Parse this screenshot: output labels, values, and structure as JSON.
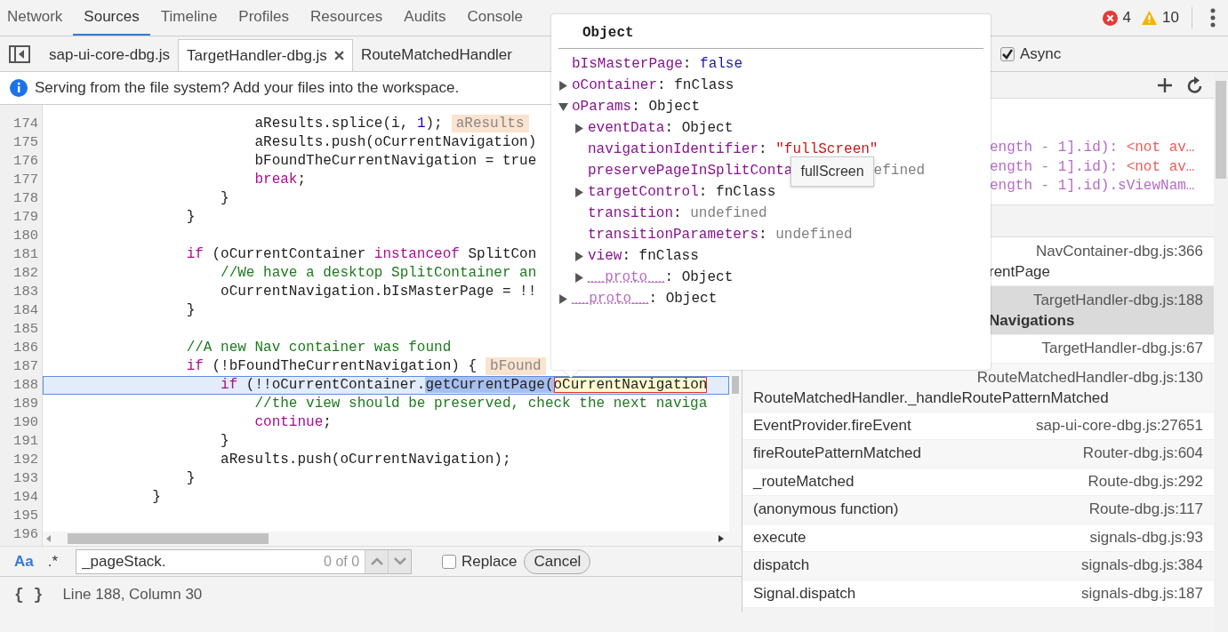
{
  "main_tabs": [
    {
      "label": "Network",
      "selected": false
    },
    {
      "label": "Sources",
      "selected": true
    },
    {
      "label": "Timeline",
      "selected": false
    },
    {
      "label": "Profiles",
      "selected": false
    },
    {
      "label": "Resources",
      "selected": false
    },
    {
      "label": "Audits",
      "selected": false
    },
    {
      "label": "Console",
      "selected": false
    }
  ],
  "issues": {
    "errors": "4",
    "warnings": "10"
  },
  "file_tabs": [
    {
      "label": "sap-ui-core-dbg.js",
      "selected": false,
      "closable": false
    },
    {
      "label": "TargetHandler-dbg.js",
      "selected": true,
      "closable": true
    },
    {
      "label": "RouteMatchedHandler",
      "selected": false,
      "closable": false
    }
  ],
  "async": {
    "label": "Async",
    "checked": true
  },
  "info_bar": "Serving from the file system? Add your files into the workspace.",
  "code": {
    "lines": [
      {
        "number": "174",
        "current": false,
        "segments": [
          {
            "kind": "plain",
            "text": "                        aResults.splice(i, "
          },
          {
            "kind": "number",
            "text": "1"
          },
          {
            "kind": "plain",
            "text": ");"
          },
          {
            "kind": "inline_value",
            "text": "aResults"
          }
        ]
      },
      {
        "number": "175",
        "current": false,
        "segments": [
          {
            "kind": "plain",
            "text": "                        aResults.push(oCurrentNavigation)"
          }
        ]
      },
      {
        "number": "176",
        "current": false,
        "segments": [
          {
            "kind": "plain",
            "text": "                        bFoundTheCurrentNavigation = true"
          }
        ]
      },
      {
        "number": "177",
        "current": false,
        "segments": [
          {
            "kind": "keyword",
            "text": "                        break"
          },
          {
            "kind": "plain",
            "text": ";"
          }
        ]
      },
      {
        "number": "178",
        "current": false,
        "segments": [
          {
            "kind": "plain",
            "text": "                    }"
          }
        ]
      },
      {
        "number": "179",
        "current": false,
        "segments": [
          {
            "kind": "plain",
            "text": "                }"
          }
        ]
      },
      {
        "number": "180",
        "current": false
      },
      {
        "number": "181",
        "current": false,
        "segments": [
          {
            "kind": "keyword",
            "text": "                if"
          },
          {
            "kind": "plain",
            "text": " (oCurrentContainer "
          },
          {
            "kind": "keyword",
            "text": "instanceof"
          },
          {
            "kind": "plain",
            "text": " SplitCon"
          }
        ]
      },
      {
        "number": "182",
        "current": false,
        "segments": [
          {
            "kind": "comment",
            "text": "                    //We have a desktop SplitContainer an"
          }
        ]
      },
      {
        "number": "183",
        "current": false,
        "segments": [
          {
            "kind": "plain",
            "text": "                    oCurrentNavigation.bIsMasterPage = !!"
          }
        ]
      },
      {
        "number": "184",
        "current": false,
        "segments": [
          {
            "kind": "plain",
            "text": "                }"
          }
        ]
      },
      {
        "number": "185",
        "current": false
      },
      {
        "number": "186",
        "current": false,
        "segments": [
          {
            "kind": "comment",
            "text": "                //A new Nav container was found"
          }
        ]
      },
      {
        "number": "187",
        "current": false,
        "segments": [
          {
            "kind": "keyword",
            "text": "                if"
          },
          {
            "kind": "plain",
            "text": " (!bFoundTheCurrentNavigation) {"
          },
          {
            "kind": "inline_value",
            "text": "bFound"
          }
        ]
      },
      {
        "number": "188",
        "current": true,
        "segments": [
          {
            "kind": "keyword",
            "text": "                    if"
          },
          {
            "kind": "plain",
            "text": " (!!oCurrentContainer."
          },
          {
            "kind": "selection",
            "text": "getCurrentPage("
          },
          {
            "kind": "evaluated",
            "text": "oCurrentNavigation"
          }
        ]
      },
      {
        "number": "189",
        "current": false,
        "segments": [
          {
            "kind": "comment",
            "text": "                        //the view should be preserved, check the next naviga"
          }
        ]
      },
      {
        "number": "190",
        "current": false,
        "segments": [
          {
            "kind": "keyword",
            "text": "                        continue"
          },
          {
            "kind": "plain",
            "text": ";"
          }
        ]
      },
      {
        "number": "191",
        "current": false,
        "segments": [
          {
            "kind": "plain",
            "text": "                    }"
          }
        ]
      },
      {
        "number": "192",
        "current": false,
        "segments": [
          {
            "kind": "plain",
            "text": "                    aResults.push(oCurrentNavigation);"
          }
        ]
      },
      {
        "number": "193",
        "current": false,
        "segments": [
          {
            "kind": "plain",
            "text": "                }"
          }
        ]
      },
      {
        "number": "194",
        "current": false,
        "segments": [
          {
            "kind": "plain",
            "text": "            }"
          }
        ]
      },
      {
        "number": "195",
        "current": false
      },
      {
        "number": "196",
        "current": false
      }
    ]
  },
  "search": {
    "case_toggle": "Aa",
    "regex_toggle": ".*",
    "query": "_pageStack.",
    "count": "0 of 0",
    "replace": {
      "label": "Replace",
      "checked": false
    },
    "cancel": "Cancel"
  },
  "status_bar": {
    "pretty_print": "{ }",
    "position": "Line 188, Column 30"
  },
  "watch": [
    {
      "expression": "ength - 1].id): ",
      "value": "<not av…"
    },
    {
      "expression": "ength - 1].id): ",
      "value": "<not av…"
    },
    {
      "expression": "ength - 1].id).sViewNam…"
    }
  ],
  "call_stack": [
    {
      "kind": "obscured",
      "function": "rentPage",
      "file": "NavContainer-dbg.js:366",
      "selected": false
    },
    {
      "kind": "obscured",
      "function": "Navigations",
      "file": "TargetHandler-dbg.js:188",
      "selected": true
    },
    {
      "kind": "single",
      "file": "TargetHandler-dbg.js:67",
      "selected": false
    },
    {
      "kind": "wrapped",
      "function": "RouteMatchedHandler._handleRoutePatternMatched",
      "file": "RouteMatchedHandler-dbg.js:130",
      "selected": false
    },
    {
      "kind": "single",
      "function": "EventProvider.fireEvent",
      "file": "sap-ui-core-dbg.js:27651",
      "selected": false
    },
    {
      "kind": "single",
      "function": "fireRoutePatternMatched",
      "file": "Router-dbg.js:604",
      "selected": false
    },
    {
      "kind": "single",
      "function": "_routeMatched",
      "file": "Route-dbg.js:292",
      "selected": false
    },
    {
      "kind": "single",
      "function": "(anonymous function)",
      "file": "Route-dbg.js:117",
      "selected": false
    },
    {
      "kind": "single",
      "function": "execute",
      "file": "signals-dbg.js:93",
      "selected": false
    },
    {
      "kind": "single",
      "function": "dispatch",
      "file": "signals-dbg.js:384",
      "selected": false
    },
    {
      "kind": "single",
      "function": "Signal.dispatch",
      "file": "signals-dbg.js:187",
      "selected": false
    }
  ],
  "popover": {
    "title": "Object",
    "tree": [
      {
        "key": "bIsMasterPage",
        "separator": ":",
        "value": "false",
        "kind": "boolean",
        "internal": false
      },
      {
        "key": "oContainer",
        "separator": ":",
        "value": "fnClass",
        "kind": "object",
        "expanded": false,
        "internal": false
      },
      {
        "key": "oParams",
        "separator": ":",
        "value": "Object",
        "kind": "object",
        "expanded": true,
        "internal": false,
        "children": [
          {
            "key": "eventData",
            "separator": ":",
            "value": "Object",
            "kind": "object",
            "expanded": false,
            "internal": false
          },
          {
            "key": "navigationIdentifier",
            "separator": ":",
            "value": "\"fullScreen\"",
            "kind": "string",
            "internal": false
          },
          {
            "key": "preservePageInSplitConta",
            "value": "efined",
            "kind": "undefined",
            "internal": false,
            "tooltip": "fullScreen"
          },
          {
            "key": "targetControl",
            "separator": ":",
            "value": "fnClass",
            "kind": "object",
            "expanded": false,
            "internal": false
          },
          {
            "key": "transition",
            "separator": ":",
            "value": "undefined",
            "kind": "undefined",
            "internal": false
          },
          {
            "key": "transitionParameters",
            "separator": ":",
            "value": "undefined",
            "kind": "undefined",
            "internal": false
          },
          {
            "key": "view",
            "separator": ":",
            "value": "fnClass",
            "kind": "object",
            "expanded": false,
            "internal": false
          },
          {
            "key": "__proto__",
            "separator": ":",
            "value": "Object",
            "kind": "object",
            "expanded": false,
            "internal": true
          }
        ]
      },
      {
        "key": "__proto__",
        "separator": ":",
        "value": "Object",
        "kind": "object",
        "expanded": false,
        "internal": true
      }
    ]
  }
}
